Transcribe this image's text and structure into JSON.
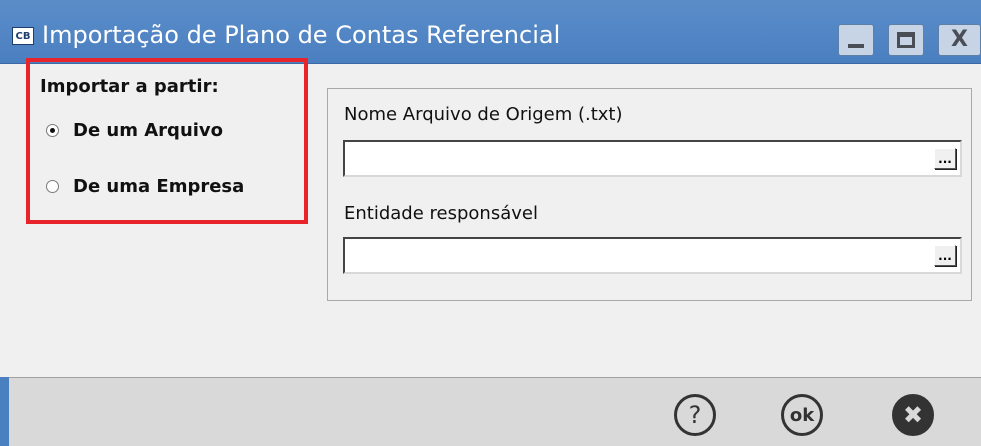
{
  "window": {
    "app_icon_text": "CB",
    "title": "Importação de Plano de Contas Referencial",
    "titlebar_color": "#4a7fc0"
  },
  "controls": {
    "minimize_icon": "minimize-icon",
    "maximize_icon": "maximize-icon",
    "close_icon": "close-icon",
    "close_glyph": "X"
  },
  "import_group": {
    "legend": "Importar a partir:",
    "options": [
      {
        "label": "De um Arquivo",
        "checked": true
      },
      {
        "label": "De uma Empresa",
        "checked": false
      }
    ],
    "highlight_color": "#e8232a"
  },
  "fields": {
    "source_file": {
      "label": "Nome Arquivo de Origem (.txt)",
      "value": "",
      "browse_label": "..."
    },
    "entity": {
      "label": "Entidade responsável",
      "value": "",
      "browse_label": "..."
    }
  },
  "footer": {
    "help_label": "?",
    "ok_label": "ok",
    "cancel_label": "✖"
  }
}
